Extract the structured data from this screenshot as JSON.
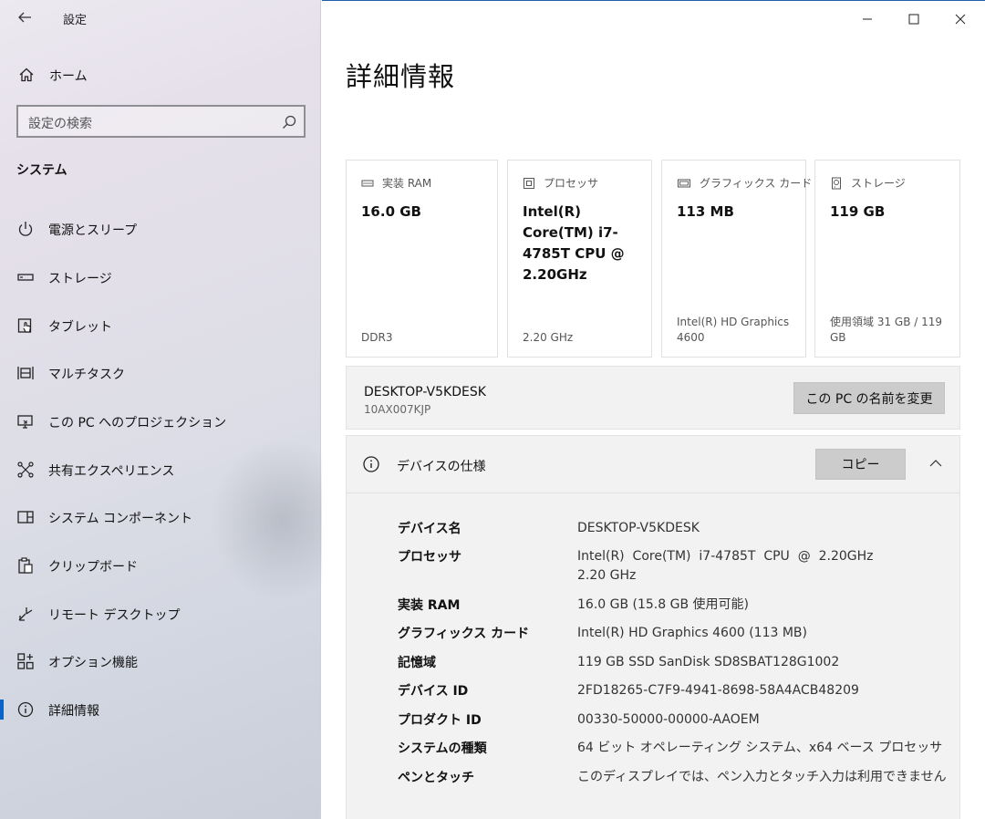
{
  "window": {
    "title": "設定"
  },
  "sidebar": {
    "home_label": "ホーム",
    "search_placeholder": "設定の検索",
    "section_title": "システム",
    "items": [
      {
        "label": "電源とスリープ",
        "icon": "power-icon"
      },
      {
        "label": "ストレージ",
        "icon": "storage-icon"
      },
      {
        "label": "タブレット",
        "icon": "tablet-icon"
      },
      {
        "label": "マルチタスク",
        "icon": "multitask-icon"
      },
      {
        "label": "この PC へのプロジェクション",
        "icon": "projection-icon"
      },
      {
        "label": "共有エクスペリエンス",
        "icon": "shared-experience-icon"
      },
      {
        "label": "システム コンポーネント",
        "icon": "system-components-icon"
      },
      {
        "label": "クリップボード",
        "icon": "clipboard-icon"
      },
      {
        "label": "リモート デスクトップ",
        "icon": "remote-desktop-icon"
      },
      {
        "label": "オプション機能",
        "icon": "optional-features-icon"
      },
      {
        "label": "詳細情報",
        "icon": "info-icon",
        "active": true
      }
    ]
  },
  "main": {
    "title": "詳細情報",
    "cards": [
      {
        "header": "実装 RAM",
        "icon": "ram-icon",
        "value": "16.0 GB",
        "footer": "DDR3"
      },
      {
        "header": "プロセッサ",
        "icon": "processor-icon",
        "value": "Intel(R) Core(TM) i7-4785T CPU @ 2.20GHz",
        "footer": "2.20 GHz"
      },
      {
        "header": "グラフィックス カード",
        "icon": "graphics-card-icon",
        "value": "113 MB",
        "footer": "Intel(R) HD Graphics 4600"
      },
      {
        "header": "ストレージ",
        "icon": "storage-drive-icon",
        "value": "119 GB",
        "footer": "使用領域 31 GB / 119 GB"
      }
    ],
    "pc": {
      "name": "DESKTOP-V5KDESK",
      "model": "10AX007KJP",
      "rename_label": "この PC の名前を変更"
    },
    "specs": {
      "header": "デバイスの仕様",
      "copy_label": "コピー",
      "rows": [
        {
          "key": "デバイス名",
          "value": "DESKTOP-V5KDESK"
        },
        {
          "key": "プロセッサ",
          "value": "Intel(R)  Core(TM)  i7-4785T  CPU  @  2.20GHz     2.20 GHz"
        },
        {
          "key": "実装 RAM",
          "value": "16.0 GB (15.8 GB 使用可能)"
        },
        {
          "key": "グラフィックス カード",
          "value": "Intel(R) HD Graphics 4600 (113 MB)"
        },
        {
          "key": "記憶域",
          "value": "119 GB SSD SanDisk SD8SBAT128G1002"
        },
        {
          "key": "デバイス ID",
          "value": "2FD18265-C7F9-4941-8698-58A4ACB48209"
        },
        {
          "key": "プロダクト ID",
          "value": "00330-50000-00000-AAOEM"
        },
        {
          "key": "システムの種類",
          "value": "64 ビット オペレーティング システム、x64 ベース プロセッサ"
        },
        {
          "key": "ペンとタッチ",
          "value": "このディスプレイでは、ペン入力とタッチ入力は利用できません"
        }
      ]
    }
  },
  "colors": {
    "accent": "#0a64c8",
    "button": "#cccccc",
    "panel": "#f2f2f2"
  }
}
